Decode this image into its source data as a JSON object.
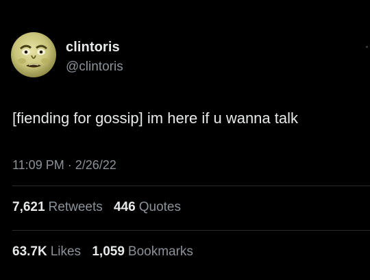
{
  "user": {
    "display_name": "clintoris",
    "handle": "@clintoris",
    "avatar_icon": "green-face-avatar"
  },
  "tweet": {
    "text": "[fiending for gossip] im here if u wanna talk",
    "time": "11:09 PM",
    "separator": " · ",
    "date": "2/26/22"
  },
  "stats": {
    "retweets_count": "7,621",
    "retweets_label": "Retweets",
    "quotes_count": "446",
    "quotes_label": "Quotes",
    "likes_count": "63.7K",
    "likes_label": "Likes",
    "bookmarks_count": "1,059",
    "bookmarks_label": "Bookmarks"
  },
  "colors": {
    "background": "#000000",
    "primary_text": "#e7e9ea",
    "secondary_text": "#8b9299",
    "divider": "#2a2d30"
  }
}
